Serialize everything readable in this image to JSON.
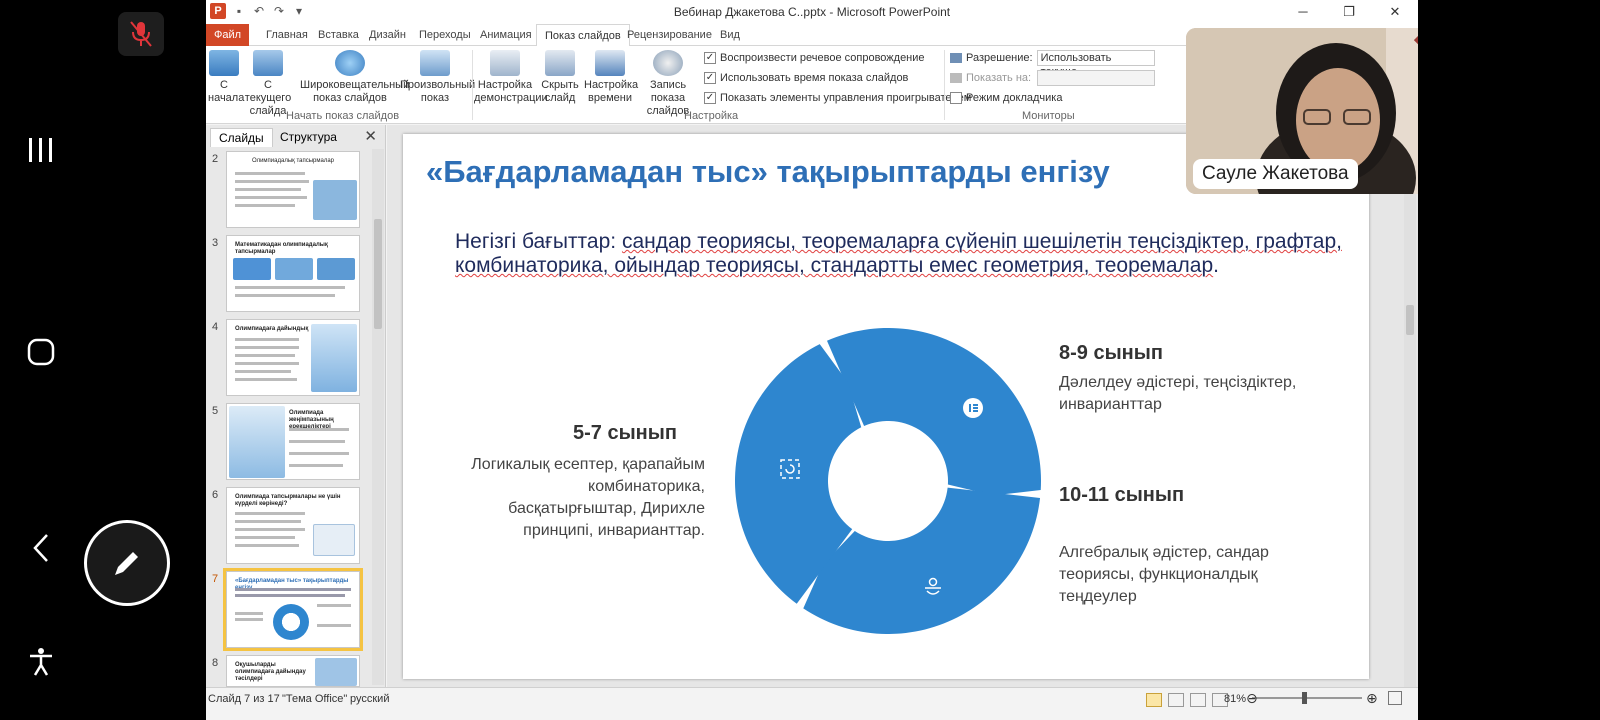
{
  "window": {
    "title": "Вебинар Джакетова С..pptx - Microsoft PowerPoint"
  },
  "tabs": [
    "Файл",
    "Главная",
    "Вставка",
    "Дизайн",
    "Переходы",
    "Анимация",
    "Показ слайдов",
    "Рецензирование",
    "Вид"
  ],
  "ribbon": {
    "btn_from_start": "С начала",
    "btn_from_current": "С текущего слайда",
    "btn_broadcast": "Широковещательный показ слайдов",
    "btn_custom": "Произвольный показ",
    "group_start": "Начать показ слайдов",
    "btn_setup": "Настройка демонстрации",
    "btn_hide": "Скрыть слайд",
    "btn_rehearse": "Настройка времени",
    "btn_record": "Запись показа слайдов",
    "chk_narration": "Воспроизвести речевое сопровождение",
    "chk_timings": "Использовать время показа слайдов",
    "chk_controls": "Показать элементы управления проигрывателем",
    "group_setup": "Настройка",
    "resolution_label": "Разрешение:",
    "resolution_value": "Использовать текуще...",
    "show_on_label": "Показать на:",
    "presenter_view": "Режим докладчика",
    "group_monitors": "Мониторы"
  },
  "pane": {
    "tab_slides": "Слайды",
    "tab_outline": "Структура",
    "thumbs": [
      {
        "num": "2",
        "title": "Олимпиадалық тапсырмалар"
      },
      {
        "num": "3",
        "title": "Математикадан олимпиадалық тапсырмалар"
      },
      {
        "num": "4",
        "title": "Олимпиадаға дайындық"
      },
      {
        "num": "5",
        "title": "Олимпиада жеңімпазының ерекшеліктері"
      },
      {
        "num": "6",
        "title": "Олимпиада тапсырмалары не үшін күрделі көрінеді?"
      },
      {
        "num": "7",
        "title": "«Бағдарламадан тыс» тақырыптарды енгізу"
      },
      {
        "num": "8",
        "title": "Оқушыларды олимпиадаға дайындау тәсілдері"
      }
    ]
  },
  "slide": {
    "title": "«Бағдарламадан тыс» тақырыптарды енгізу",
    "subtitle_plain1": "Негізгі бағыттар: ",
    "subtitle_u1": "сандар теориясы, теоремаларға сүйеніп шешілетін теңсіздіктер, графтар, комбинаторика, ойындар теориясы, стандартты емес геометрия, теоремалар",
    "subtitle_end": ".",
    "g1_head": "5-7  сынып",
    "g1_text": "Логикалық есептер, қарапайым комбинаторика, басқатырғыштар, Дирихле принципі, инварианттар.",
    "g2_head": "8-9 сынып",
    "g2_text": "Дәлелдеу әдістері, теңсіздіктер, инварианттар",
    "g3_head": "10-11 сынып",
    "g3_text": "Алгебралық әдістер, сандар теориясы, функционалдық теңдеулер"
  },
  "chart_data": {
    "type": "pie",
    "categories": [
      "5-7  сынып",
      "8-9 сынып",
      "10-11 сынып"
    ],
    "values": [
      33.3,
      33.3,
      33.4
    ],
    "color": "#2e86cf"
  },
  "status": {
    "slide": "Слайд 7 из 17",
    "theme": "\"Тема Office\"",
    "lang": "русский",
    "zoom": "81%"
  },
  "cam": {
    "name": "Сауле Жакетова"
  }
}
